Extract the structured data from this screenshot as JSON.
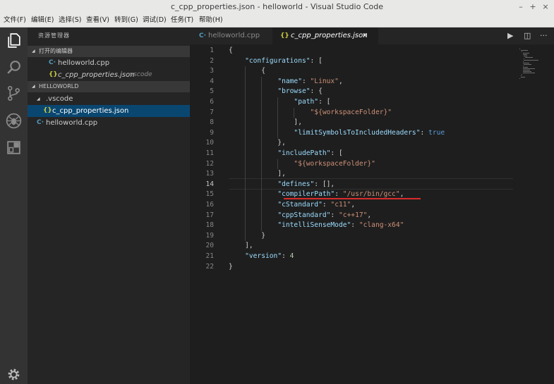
{
  "window": {
    "title": "c_cpp_properties.json - helloworld - Visual Studio Code",
    "minimize": "–",
    "maximize": "+",
    "close": "×"
  },
  "menu": [
    "文件(F)",
    "编辑(E)",
    "选择(S)",
    "查看(V)",
    "转到(G)",
    "调试(D)",
    "任务(T)",
    "帮助(H)"
  ],
  "activity": [
    "files-icon",
    "search-icon",
    "source-control-icon",
    "debug-icon",
    "extensions-icon",
    "gear-icon"
  ],
  "sidebar": {
    "title": "资源管理器",
    "open_editors": {
      "header": "打开的编辑器",
      "items": [
        {
          "name": "helloworld.cpp",
          "icon": "C·",
          "icon_type": "cpp-file-icon"
        },
        {
          "name": "c_cpp_properties.json",
          "icon": "{}",
          "icon_type": "json-file-icon",
          "path": ".vscode"
        }
      ]
    },
    "workspace": {
      "header": "HELLOWORLD",
      "folder": ".vscode",
      "items": [
        {
          "name": "c_cpp_properties.json",
          "icon": "{}",
          "icon_type": "json-file-icon"
        },
        {
          "name": "helloworld.cpp",
          "icon": "C·",
          "icon_type": "cpp-file-icon"
        }
      ]
    }
  },
  "tabs": [
    {
      "label": "helloworld.cpp",
      "icon": "C·",
      "active": false
    },
    {
      "label": "c_cpp_properties.json",
      "icon": "{}",
      "active": true,
      "close": "×"
    }
  ],
  "editor_actions": {
    "run": "▶",
    "split": "◫",
    "more": "···"
  },
  "editor": {
    "current_line": 14,
    "lines": [
      "{",
      "    \"configurations\": [",
      "        {",
      "            \"name\": \"Linux\",",
      "            \"browse\": {",
      "                \"path\": [",
      "                    \"${workspaceFolder}\"",
      "                ],",
      "                \"limitSymbolsToIncludedHeaders\": true",
      "            },",
      "            \"includePath\": [",
      "                \"${workspaceFolder}\"",
      "            ],",
      "            \"defines\": [],",
      "            \"compilerPath\": \"/usr/bin/gcc\",",
      "            \"cStandard\": \"c11\",",
      "            \"cppStandard\": \"c++17\",",
      "            \"intelliSenseMode\": \"clang-x64\"",
      "        }",
      "    ],",
      "    \"version\": 4",
      "}"
    ]
  },
  "colors": {
    "accent_selection": "#094771",
    "activity_bar": "#333333",
    "sidebar": "#252526",
    "editor_bg": "#1e1e1e",
    "error_squiggle": "#d82c2c"
  }
}
